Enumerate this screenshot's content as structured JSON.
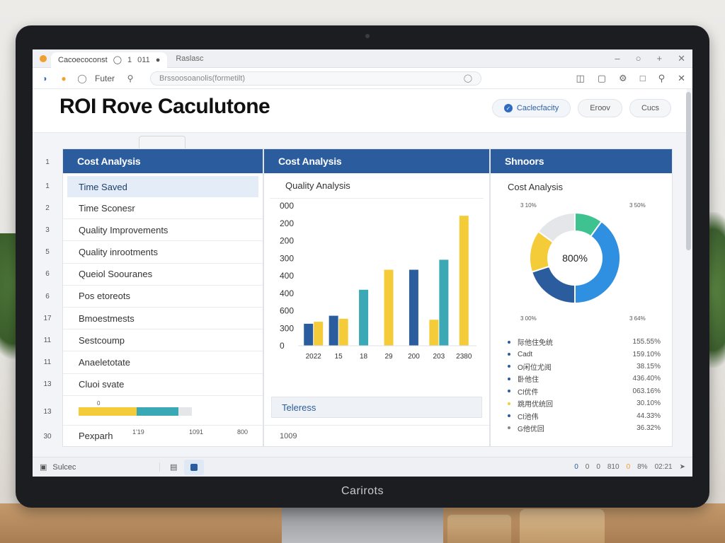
{
  "browser": {
    "tab_title": "Cacoecoconst",
    "tab_num1": "1",
    "tab_num2": "011",
    "extra_tab": "Raslasc",
    "filter_label": "Futer",
    "address_placeholder": "Brssoosoanolis(formetilt)"
  },
  "app": {
    "title": "ROI Rove Caculutone",
    "buttons": [
      "Caclecfacity",
      "Eroov",
      "Cucs"
    ]
  },
  "row_numbers": [
    "1",
    "1",
    "2",
    "3",
    "5",
    "6",
    "6",
    "17",
    "11",
    "11",
    "13",
    "13",
    "30"
  ],
  "panel_left": {
    "header": "Cost Analysis",
    "rows": [
      "Time Saved",
      "Time Sconesr",
      "Quality Improvements",
      "Quality inrootments",
      "Queiol Soouranes",
      "Pos etoreots",
      "Bmoestmests",
      "Sestcoump",
      "Anaeletotate",
      "Cluoi svate"
    ],
    "progress_label": "0",
    "progress_yellow": 0.51,
    "progress_teal": 0.37,
    "footer_label": "Pexparh",
    "footer_values": [
      "1'19",
      "1091",
      "800"
    ]
  },
  "panel_mid": {
    "header": "Cost Analysis",
    "subtitle": "Quality Analysis",
    "legend_label": "Teleress",
    "footer_label": "1009"
  },
  "panel_right": {
    "header": "Shnoors",
    "subtitle": "Cost Analysis",
    "center_label": "800%",
    "slice_labels": [
      "3 10%",
      "3 50%",
      "3 00%",
      "3 64%"
    ],
    "items": [
      {
        "label": "际他住免统",
        "value": "155.55%",
        "color": "#2b5d9e"
      },
      {
        "label": "Cadt",
        "value": "159.10%",
        "color": "#2b5d9e"
      },
      {
        "label": "O闲位尤阅",
        "value": "38.15%",
        "color": "#2b5d9e"
      },
      {
        "label": "卧他住",
        "value": "436.40%",
        "color": "#2b5d9e"
      },
      {
        "label": "Cl优件",
        "value": "063.16%",
        "color": "#2b5d9e"
      },
      {
        "label": "跳用优统回",
        "value": "30.10%",
        "color": "#f4cc3a"
      },
      {
        "label": "Cl池伟",
        "value": "44.33%",
        "color": "#2b5d9e"
      },
      {
        "label": "G他优回",
        "value": "36.32%",
        "color": "#888888"
      }
    ]
  },
  "statusbar": {
    "search_label": "Sulcec",
    "right_labels": [
      "0",
      "0",
      "0",
      "810",
      "0",
      "8%",
      "02:21"
    ]
  },
  "brand": "Carirots",
  "chart_data": [
    {
      "type": "bar",
      "title": "Quality Analysis",
      "categories": [
        "2022",
        "15",
        "18",
        "29",
        "200",
        "203",
        "2380"
      ],
      "series": [
        {
          "values": [
            110,
            150,
            0,
            0,
            380,
            0,
            0
          ],
          "color": "#2b5d9e"
        },
        {
          "values": [
            120,
            135,
            0,
            380,
            0,
            130,
            650
          ],
          "color": "#f4cc3a"
        },
        {
          "values": [
            0,
            0,
            280,
            0,
            0,
            430,
            0
          ],
          "color": "#3ba9b5"
        }
      ],
      "ytick_labels": [
        "000",
        "200",
        "200",
        "300",
        "400",
        "400",
        "600",
        "300",
        "0"
      ],
      "ylim": [
        0,
        700
      ]
    },
    {
      "type": "pie",
      "title": "Cost Analysis",
      "labels": [
        "3 10%",
        "3 50%",
        "3 00%",
        "3 64%"
      ],
      "values": [
        10,
        40,
        20,
        15,
        15
      ],
      "colors": [
        "#3ec28f",
        "#2f8fe0",
        "#2b5d9e",
        "#f4cc3a",
        "#e4e6ea"
      ]
    }
  ]
}
